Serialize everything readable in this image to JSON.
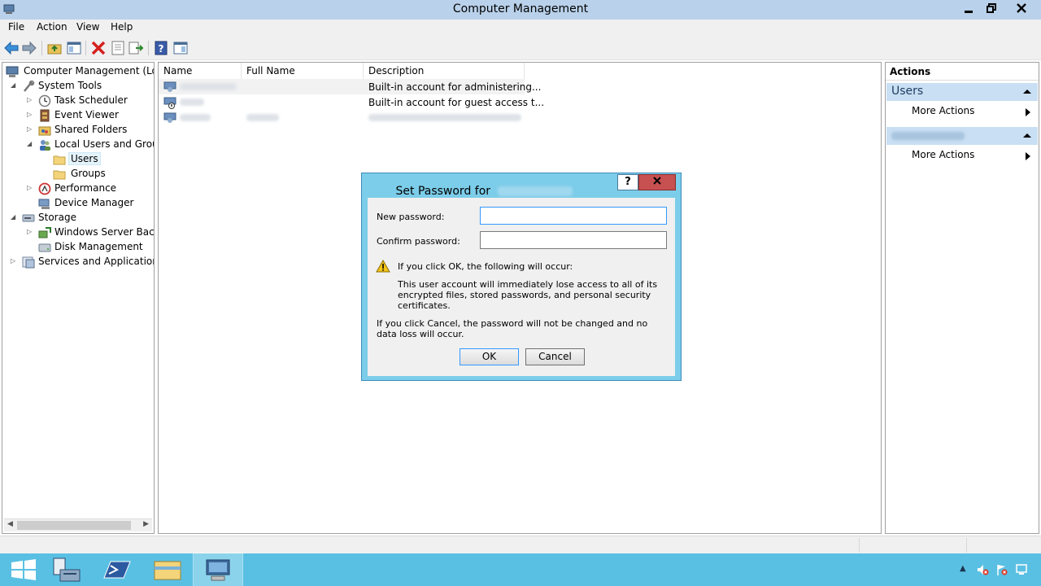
{
  "window": {
    "title": "Computer Management"
  },
  "menu": {
    "items": [
      "File",
      "Action",
      "View",
      "Help"
    ]
  },
  "tree": {
    "items": [
      {
        "label": "Computer Management (Local",
        "name": "tree-item-computer-management",
        "icon": "computer-management-icon"
      },
      {
        "label": "System Tools",
        "name": "tree-item-system-tools",
        "icon": "system-tools-icon"
      },
      {
        "label": "Task Scheduler",
        "name": "tree-item-task-scheduler",
        "icon": "clock-icon"
      },
      {
        "label": "Event Viewer",
        "name": "tree-item-event-viewer",
        "icon": "event-viewer-icon"
      },
      {
        "label": "Shared Folders",
        "name": "tree-item-shared-folders",
        "icon": "shared-folder-icon"
      },
      {
        "label": "Local Users and Groups",
        "name": "tree-item-local-users-and-groups",
        "icon": "users-group-icon"
      },
      {
        "label": "Users",
        "name": "tree-item-users",
        "icon": "folder-icon"
      },
      {
        "label": "Groups",
        "name": "tree-item-groups",
        "icon": "folder-icon"
      },
      {
        "label": "Performance",
        "name": "tree-item-performance",
        "icon": "performance-icon"
      },
      {
        "label": "Device Manager",
        "name": "tree-item-device-manager",
        "icon": "device-manager-icon"
      },
      {
        "label": "Storage",
        "name": "tree-item-storage",
        "icon": "storage-icon"
      },
      {
        "label": "Windows Server Backup",
        "name": "tree-item-windows-server-backup",
        "icon": "backup-icon"
      },
      {
        "label": "Disk Management",
        "name": "tree-item-disk-management",
        "icon": "disk-icon"
      },
      {
        "label": "Services and Applications",
        "name": "tree-item-services-and-applications",
        "icon": "services-icon"
      }
    ]
  },
  "list": {
    "columns": [
      "Name",
      "Full Name",
      "Description"
    ],
    "rows": [
      {
        "description": "Built-in account for administering..."
      },
      {
        "description": "Built-in account for guest access t..."
      },
      {
        "description": ""
      }
    ]
  },
  "actions": {
    "title": "Actions",
    "section1": "Users",
    "more_actions_1": "More Actions",
    "more_actions_2": "More Actions"
  },
  "dialog": {
    "title": "Set Password for",
    "help": "?",
    "close": "x",
    "new_password_label": "New password:",
    "confirm_password_label": "Confirm password:",
    "new_password_value": "",
    "confirm_password_value": "",
    "warning_heading": "If you click OK, the following will occur:",
    "warning_body": "This user account will immediately lose access to all of its encrypted files, stored passwords, and personal security certificates.",
    "cancel_note": "If you click Cancel, the password will not be changed and no data loss will occur.",
    "ok_label": "OK",
    "cancel_label": "Cancel"
  },
  "colors": {
    "titlebar": "#b9d1ea",
    "taskbar": "#5ac0e3",
    "dialog_frame": "#7ccde9",
    "close_button": "#c75050",
    "actions_header": "#c9dff3"
  }
}
